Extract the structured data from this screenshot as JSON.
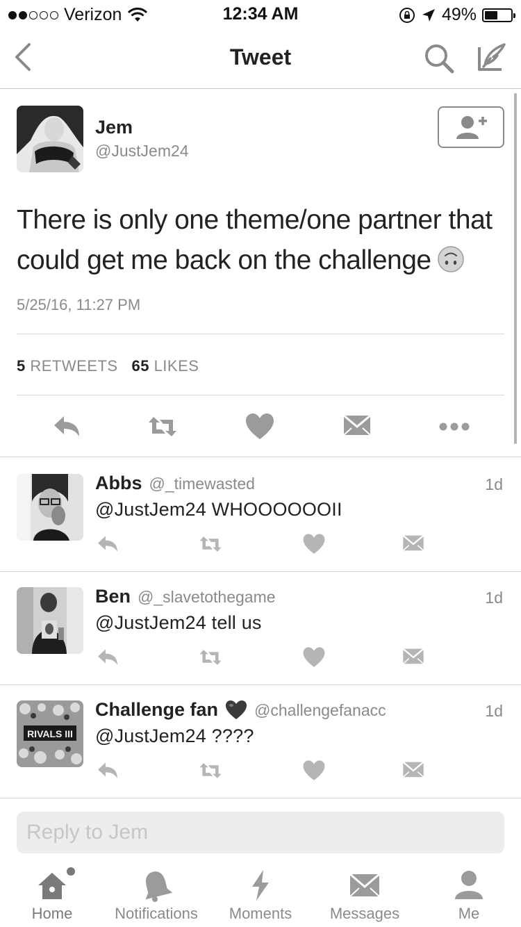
{
  "status_bar": {
    "carrier": "Verizon",
    "time": "12:34 AM",
    "battery": "49%",
    "battery_level": 0.49,
    "signal_bars": 2
  },
  "nav": {
    "title": "Tweet"
  },
  "tweet": {
    "name": "Jem",
    "handle": "@JustJem24",
    "text": "There is only one theme/one partner that could get me back on the challenge",
    "date": "5/25/16, 11:27 PM",
    "retweets_count": "5",
    "retweets_label": "RETWEETS",
    "likes_count": "65",
    "likes_label": "LIKES"
  },
  "replies": [
    {
      "name": "Abbs",
      "handle": "@_timewasted",
      "time": "1d",
      "mention": "@JustJem24",
      "text": "WHOOOOOOII"
    },
    {
      "name": "Ben",
      "handle": "@_slavetothegame",
      "time": "1d",
      "mention": "@JustJem24",
      "text": "tell us"
    },
    {
      "name": "Challenge fan",
      "handle": "@challengefanacc",
      "time": "1d",
      "mention": "@JustJem24",
      "text": "????",
      "avatar_text": "RIVALS III"
    }
  ],
  "reply_box": {
    "placeholder": "Reply to Jem"
  },
  "tabs": [
    {
      "label": "Home",
      "icon": "home-icon"
    },
    {
      "label": "Notifications",
      "icon": "bell-icon"
    },
    {
      "label": "Moments",
      "icon": "lightning-icon"
    },
    {
      "label": "Messages",
      "icon": "envelope-icon"
    },
    {
      "label": "Me",
      "icon": "person-icon"
    }
  ],
  "colors": {
    "text": "#222222",
    "muted": "#8a8a8a",
    "icon": "#9b9b9b",
    "divider": "#d0d0d0"
  }
}
